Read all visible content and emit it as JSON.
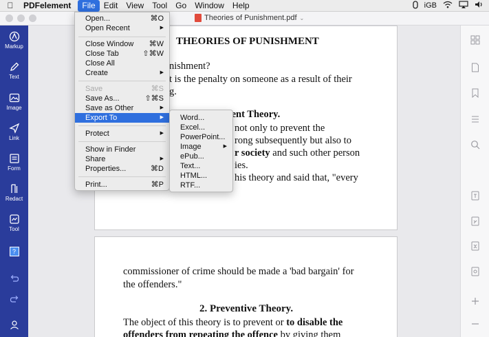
{
  "menubar": {
    "app_name": "PDFelement",
    "items": [
      "File",
      "Edit",
      "View",
      "Tool",
      "Go",
      "Window",
      "Help"
    ],
    "status_right": "iGB"
  },
  "window": {
    "doc_title": "Theories of Punishment.pdf"
  },
  "sidebar": {
    "items": [
      {
        "label": "Markup",
        "icon": "markup-icon"
      },
      {
        "label": "Text",
        "icon": "pencil-icon"
      },
      {
        "label": "Image",
        "icon": "image-icon"
      },
      {
        "label": "Link",
        "icon": "link-icon"
      },
      {
        "label": "Form",
        "icon": "form-icon"
      },
      {
        "label": "Redact",
        "icon": "redact-icon"
      },
      {
        "label": "Tool",
        "icon": "tool-icon"
      }
    ],
    "help_badge": "?"
  },
  "file_menu": {
    "items": [
      {
        "label": "Open...",
        "shortcut": "⌘O"
      },
      {
        "label": "Open Recent",
        "shortcut": "▶"
      },
      {
        "label": "Close Window",
        "shortcut": "⌘W"
      },
      {
        "label": "Close Tab",
        "shortcut": "⇧⌘W"
      },
      {
        "label": "Close All",
        "shortcut": ""
      },
      {
        "label": "Create",
        "shortcut": "▶"
      },
      {
        "label": "Save",
        "shortcut": "⌘S"
      },
      {
        "label": "Save As...",
        "shortcut": "⇧⌘S"
      },
      {
        "label": "Save as Other",
        "shortcut": "▶"
      },
      {
        "label": "Export To",
        "shortcut": "▶"
      },
      {
        "label": "Protect",
        "shortcut": "▶"
      },
      {
        "label": "Show in Finder",
        "shortcut": ""
      },
      {
        "label": "Share",
        "shortcut": "▶"
      },
      {
        "label": "Properties...",
        "shortcut": "⌘D"
      },
      {
        "label": "Print...",
        "shortcut": "⌘P"
      }
    ]
  },
  "export_menu": {
    "items": [
      "Word...",
      "Excel...",
      "PowerPoint...",
      "Image",
      "ePub...",
      "Text...",
      "HTML...",
      "RTF..."
    ],
    "image_arrow": "▶"
  },
  "document": {
    "page1": {
      "title": "THEORIES OF PUNISHMENT",
      "l1": "nishment?",
      "l2": "t is the penalty on someone as a result of their",
      "l3": "g.",
      "heading": "rrent Theory.",
      "l4": "not only to prevent the",
      "l5": "rong subsequently but also to",
      "l6a": "r society",
      "l6b": " and such other person",
      "l7": "ies.",
      "l8": "his theory and said that, \"every"
    },
    "page2": {
      "l1": "commissioner of crime should be made a 'bad bargain' for",
      "l2": "the offenders.\"",
      "heading": "2. Preventive Theory.",
      "l3a": "The object of this theory is to prevent or ",
      "l3b": "to disable the",
      "l4a": "offenders from repeating the offence",
      "l4b": " by giving them"
    }
  },
  "colors": {
    "sidebar_bg": "#2a3c9b",
    "menu_highlight": "#2f6fde"
  }
}
